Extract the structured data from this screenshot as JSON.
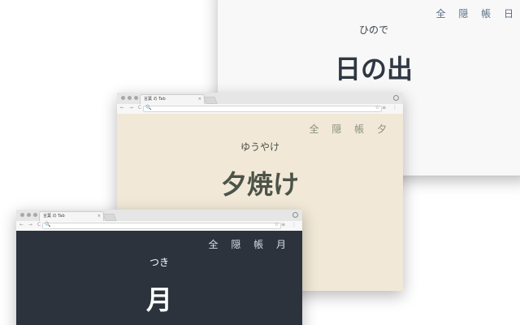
{
  "browser": {
    "tab_title": "言葉 の Tab",
    "tab_close": "×",
    "nav_glyphs": "← → C",
    "search_glyph": "🔍",
    "star_glyph": "☆",
    "menu_glyphs": "≡ ⋮",
    "profile_glyph": "◉"
  },
  "cards": {
    "sunrise": {
      "corner": "全 隠 帳 日",
      "reading": "ひので",
      "word": "日の出",
      "bg": "#f8f8f9",
      "text": "#2f3842"
    },
    "sunset": {
      "corner": "全 隠 帳 夕",
      "reading": "ゆうやけ",
      "word": "夕焼け",
      "bg": "#f1e8d7",
      "text": "#4c5349"
    },
    "moon": {
      "corner": "全 隠 帳 月",
      "reading": "つき",
      "word": "月",
      "bg": "#2c333d",
      "text": "#ffffff"
    }
  }
}
